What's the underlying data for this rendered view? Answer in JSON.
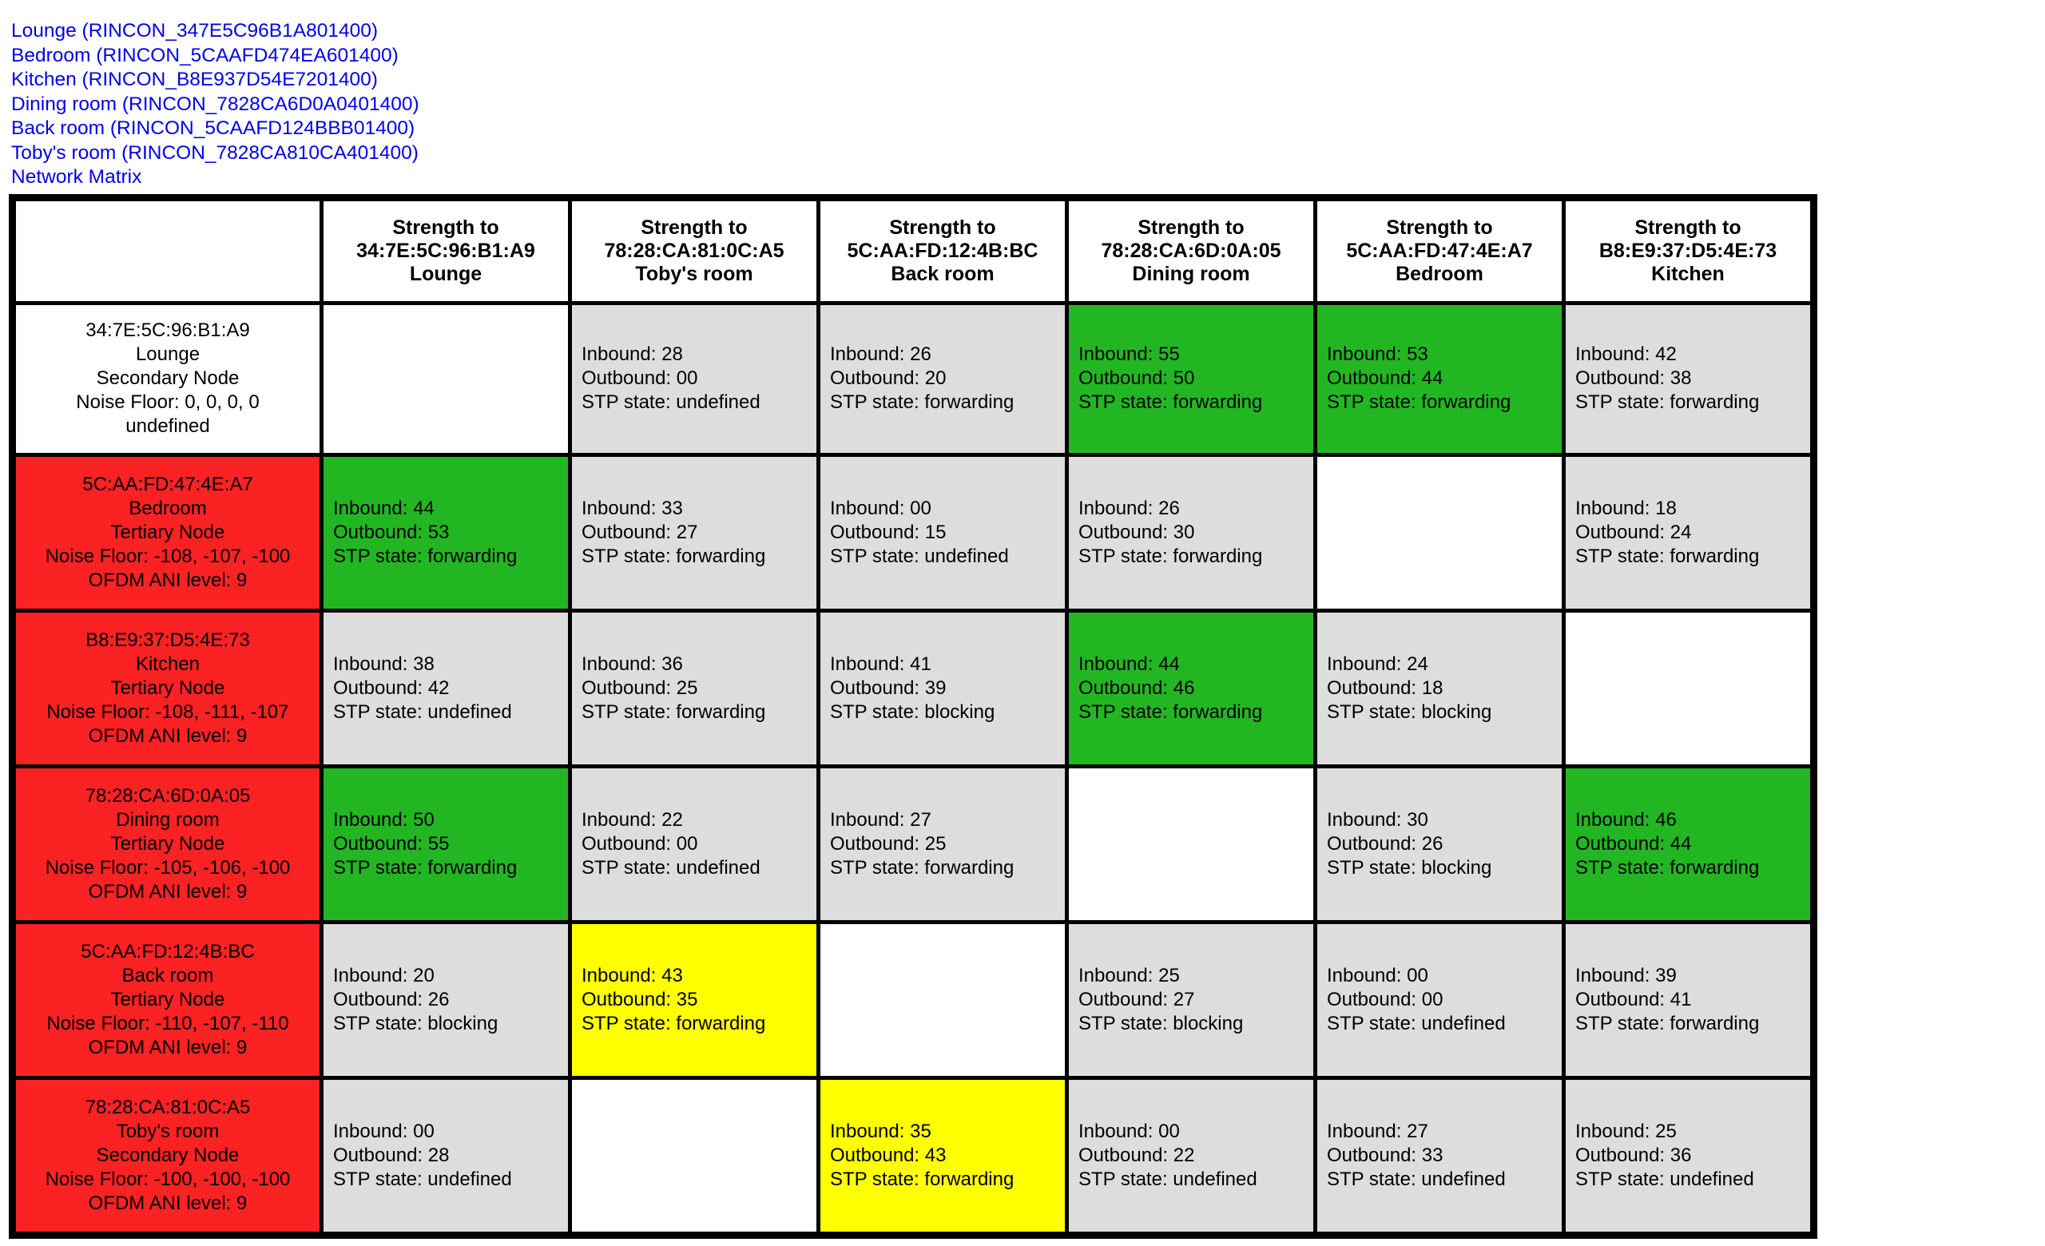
{
  "links": [
    "Lounge (RINCON_347E5C96B1A801400)",
    "Bedroom (RINCON_5CAAFD474EA601400)",
    "Kitchen (RINCON_B8E937D54E7201400)",
    "Dining room (RINCON_7828CA6D0A0401400)",
    "Back room (RINCON_5CAAFD124BBB01400)",
    "Toby's room (RINCON_7828CA810CA401400)",
    "Network Matrix"
  ],
  "colors": {
    "link": "#0000ee",
    "grid": "#000000",
    "cell_default": "#dddddd",
    "cell_strong": "#22b722",
    "cell_medium": "#ffff00",
    "cell_rowhead": "#fa2222",
    "cell_empty": "#ffffff"
  },
  "table": {
    "corner_label": "",
    "columns": [
      {
        "prefix": "Strength to",
        "mac": "34:7E:5C:96:B1:A9",
        "room": "Lounge"
      },
      {
        "prefix": "Strength to",
        "mac": "78:28:CA:81:0C:A5",
        "room": "Toby's room"
      },
      {
        "prefix": "Strength to",
        "mac": "5C:AA:FD:12:4B:BC",
        "room": "Back room"
      },
      {
        "prefix": "Strength to",
        "mac": "78:28:CA:6D:0A:05",
        "room": "Dining room"
      },
      {
        "prefix": "Strength to",
        "mac": "5C:AA:FD:47:4E:A7",
        "room": "Bedroom"
      },
      {
        "prefix": "Strength to",
        "mac": "B8:E9:37:D5:4E:73",
        "room": "Kitchen"
      }
    ],
    "rows": [
      {
        "header": {
          "mac": "34:7E:5C:96:B1:A9",
          "room": "Lounge",
          "role": "Secondary Node",
          "noise": "Noise Floor: 0, 0, 0, 0",
          "ani": "undefined",
          "fill": "white"
        },
        "cells": [
          {
            "fill": "white"
          },
          {
            "fill": "grey",
            "inbound": "Inbound: 28",
            "outbound": "Outbound: 00",
            "stp": "STP state: undefined"
          },
          {
            "fill": "grey",
            "inbound": "Inbound: 26",
            "outbound": "Outbound: 20",
            "stp": "STP state: forwarding"
          },
          {
            "fill": "green",
            "inbound": "Inbound: 55",
            "outbound": "Outbound: 50",
            "stp": "STP state: forwarding"
          },
          {
            "fill": "green",
            "inbound": "Inbound: 53",
            "outbound": "Outbound: 44",
            "stp": "STP state: forwarding"
          },
          {
            "fill": "grey",
            "inbound": "Inbound: 42",
            "outbound": "Outbound: 38",
            "stp": "STP state: forwarding"
          }
        ]
      },
      {
        "header": {
          "mac": "5C:AA:FD:47:4E:A7",
          "room": "Bedroom",
          "role": "Tertiary Node",
          "noise": "Noise Floor: -108, -107, -100",
          "ani": "OFDM ANI level: 9",
          "fill": "red"
        },
        "cells": [
          {
            "fill": "green",
            "inbound": "Inbound: 44",
            "outbound": "Outbound: 53",
            "stp": "STP state: forwarding"
          },
          {
            "fill": "grey",
            "inbound": "Inbound: 33",
            "outbound": "Outbound: 27",
            "stp": "STP state: forwarding"
          },
          {
            "fill": "grey",
            "inbound": "Inbound: 00",
            "outbound": "Outbound: 15",
            "stp": "STP state: undefined"
          },
          {
            "fill": "grey",
            "inbound": "Inbound: 26",
            "outbound": "Outbound: 30",
            "stp": "STP state: forwarding"
          },
          {
            "fill": "white"
          },
          {
            "fill": "grey",
            "inbound": "Inbound: 18",
            "outbound": "Outbound: 24",
            "stp": "STP state: forwarding"
          }
        ]
      },
      {
        "header": {
          "mac": "B8:E9:37:D5:4E:73",
          "room": "Kitchen",
          "role": "Tertiary Node",
          "noise": "Noise Floor: -108, -111, -107",
          "ani": "OFDM ANI level: 9",
          "fill": "red"
        },
        "cells": [
          {
            "fill": "grey",
            "inbound": "Inbound: 38",
            "outbound": "Outbound: 42",
            "stp": "STP state: undefined"
          },
          {
            "fill": "grey",
            "inbound": "Inbound: 36",
            "outbound": "Outbound: 25",
            "stp": "STP state: forwarding"
          },
          {
            "fill": "grey",
            "inbound": "Inbound: 41",
            "outbound": "Outbound: 39",
            "stp": "STP state: blocking"
          },
          {
            "fill": "green",
            "inbound": "Inbound: 44",
            "outbound": "Outbound: 46",
            "stp": "STP state: forwarding"
          },
          {
            "fill": "grey",
            "inbound": "Inbound: 24",
            "outbound": "Outbound: 18",
            "stp": "STP state: blocking"
          },
          {
            "fill": "white"
          }
        ]
      },
      {
        "header": {
          "mac": "78:28:CA:6D:0A:05",
          "room": "Dining room",
          "role": "Tertiary Node",
          "noise": "Noise Floor: -105, -106, -100",
          "ani": "OFDM ANI level: 9",
          "fill": "red"
        },
        "cells": [
          {
            "fill": "green",
            "inbound": "Inbound: 50",
            "outbound": "Outbound: 55",
            "stp": "STP state: forwarding"
          },
          {
            "fill": "grey",
            "inbound": "Inbound: 22",
            "outbound": "Outbound: 00",
            "stp": "STP state: undefined"
          },
          {
            "fill": "grey",
            "inbound": "Inbound: 27",
            "outbound": "Outbound: 25",
            "stp": "STP state: forwarding"
          },
          {
            "fill": "white"
          },
          {
            "fill": "grey",
            "inbound": "Inbound: 30",
            "outbound": "Outbound: 26",
            "stp": "STP state: blocking"
          },
          {
            "fill": "green",
            "inbound": "Inbound: 46",
            "outbound": "Outbound: 44",
            "stp": "STP state: forwarding"
          }
        ]
      },
      {
        "header": {
          "mac": "5C:AA:FD:12:4B:BC",
          "room": "Back room",
          "role": "Tertiary Node",
          "noise": "Noise Floor: -110, -107, -110",
          "ani": "OFDM ANI level: 9",
          "fill": "red"
        },
        "cells": [
          {
            "fill": "grey",
            "inbound": "Inbound: 20",
            "outbound": "Outbound: 26",
            "stp": "STP state: blocking"
          },
          {
            "fill": "yellow",
            "inbound": "Inbound: 43",
            "outbound": "Outbound: 35",
            "stp": "STP state: forwarding"
          },
          {
            "fill": "white"
          },
          {
            "fill": "grey",
            "inbound": "Inbound: 25",
            "outbound": "Outbound: 27",
            "stp": "STP state: blocking"
          },
          {
            "fill": "grey",
            "inbound": "Inbound: 00",
            "outbound": "Outbound: 00",
            "stp": "STP state: undefined"
          },
          {
            "fill": "grey",
            "inbound": "Inbound: 39",
            "outbound": "Outbound: 41",
            "stp": "STP state: forwarding"
          }
        ]
      },
      {
        "header": {
          "mac": "78:28:CA:81:0C:A5",
          "room": "Toby's room",
          "role": "Secondary Node",
          "noise": "Noise Floor: -100, -100, -100",
          "ani": "OFDM ANI level: 9",
          "fill": "red"
        },
        "cells": [
          {
            "fill": "grey",
            "inbound": "Inbound: 00",
            "outbound": "Outbound: 28",
            "stp": "STP state: undefined"
          },
          {
            "fill": "white"
          },
          {
            "fill": "yellow",
            "inbound": "Inbound: 35",
            "outbound": "Outbound: 43",
            "stp": "STP state: forwarding"
          },
          {
            "fill": "grey",
            "inbound": "Inbound: 00",
            "outbound": "Outbound: 22",
            "stp": "STP state: undefined"
          },
          {
            "fill": "grey",
            "inbound": "Inbound: 27",
            "outbound": "Outbound: 33",
            "stp": "STP state: undefined"
          },
          {
            "fill": "grey",
            "inbound": "Inbound: 25",
            "outbound": "Outbound: 36",
            "stp": "STP state: undefined"
          }
        ]
      }
    ]
  }
}
